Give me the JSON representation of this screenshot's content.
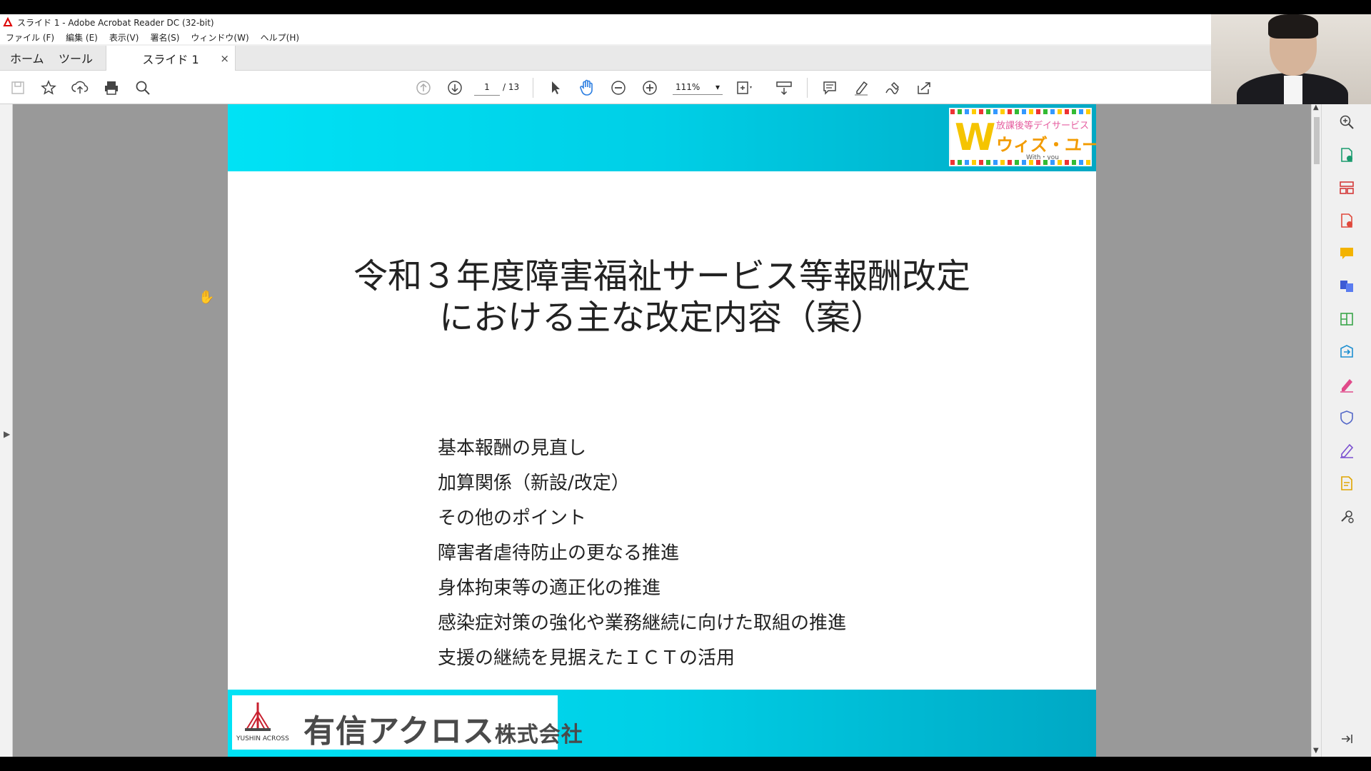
{
  "window": {
    "title": "スライド 1 - Adobe Acrobat Reader DC (32-bit)"
  },
  "menu": [
    "ファイル (F)",
    "編集 (E)",
    "表示(V)",
    "署名(S)",
    "ウィンドウ(W)",
    "ヘルプ(H)"
  ],
  "tabs": {
    "home": "ホーム",
    "tools": "ツール",
    "document": "スライド 1",
    "close": "×"
  },
  "toolbar": {
    "page_current": "1",
    "page_total": "/ 13",
    "zoom": "111%",
    "icons": [
      "save-icon",
      "star-icon",
      "upload-icon",
      "print-icon",
      "search-icon",
      "page-up-icon",
      "page-down-icon",
      "select-cursor-icon",
      "hand-icon",
      "zoom-out-icon",
      "zoom-in-icon",
      "fit-page-icon",
      "scroll-mode-icon",
      "comment-icon",
      "highlight-icon",
      "sign-icon",
      "share-icon"
    ]
  },
  "slide": {
    "title_line1": "令和３年度障害福祉サービス等報酬改定",
    "title_line2": "における主な改定内容（案）",
    "items": [
      "基本報酬の見直し",
      "加算関係（新設/改定）",
      "その他のポイント",
      "障害者虐待防止の更なる推進",
      "身体拘束等の適正化の推進",
      "感染症対策の強化や業務継続に向けた取組の推進",
      "支援の継続を見据えたＩＣＴの活用"
    ],
    "logo_top": {
      "letter": "W",
      "sub": "放課後等デイサービス",
      "main": "ウィズ・ユー",
      "en": "With・you"
    },
    "logo_bottom": {
      "mark_text": "YUSHIN ACROSS",
      "company_main": "有信アクロス",
      "company_suffix": "株式会社"
    },
    "colors": {
      "banner_start": "#00e2f5",
      "banner_end": "#00a8c4"
    }
  },
  "right_panel_icons": [
    "zoom-icon",
    "export-pdf-icon",
    "organize-pages-icon",
    "create-pdf-icon",
    "comment-icon",
    "combine-files-icon",
    "compress-icon",
    "send-icon",
    "fill-sign-icon",
    "protect-icon",
    "request-signature-icon",
    "edit-pdf-icon",
    "more-tools-icon",
    "collapse-panel-icon"
  ]
}
